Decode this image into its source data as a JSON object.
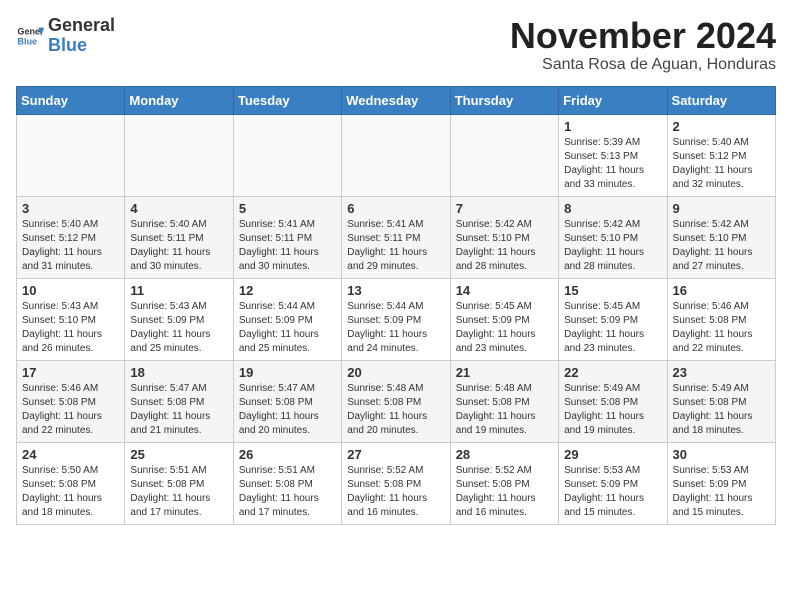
{
  "header": {
    "logo_line1": "General",
    "logo_line2": "Blue",
    "month_title": "November 2024",
    "subtitle": "Santa Rosa de Aguan, Honduras"
  },
  "weekdays": [
    "Sunday",
    "Monday",
    "Tuesday",
    "Wednesday",
    "Thursday",
    "Friday",
    "Saturday"
  ],
  "weeks": [
    [
      {
        "day": "",
        "info": ""
      },
      {
        "day": "",
        "info": ""
      },
      {
        "day": "",
        "info": ""
      },
      {
        "day": "",
        "info": ""
      },
      {
        "day": "",
        "info": ""
      },
      {
        "day": "1",
        "info": "Sunrise: 5:39 AM\nSunset: 5:13 PM\nDaylight: 11 hours\nand 33 minutes."
      },
      {
        "day": "2",
        "info": "Sunrise: 5:40 AM\nSunset: 5:12 PM\nDaylight: 11 hours\nand 32 minutes."
      }
    ],
    [
      {
        "day": "3",
        "info": "Sunrise: 5:40 AM\nSunset: 5:12 PM\nDaylight: 11 hours\nand 31 minutes."
      },
      {
        "day": "4",
        "info": "Sunrise: 5:40 AM\nSunset: 5:11 PM\nDaylight: 11 hours\nand 30 minutes."
      },
      {
        "day": "5",
        "info": "Sunrise: 5:41 AM\nSunset: 5:11 PM\nDaylight: 11 hours\nand 30 minutes."
      },
      {
        "day": "6",
        "info": "Sunrise: 5:41 AM\nSunset: 5:11 PM\nDaylight: 11 hours\nand 29 minutes."
      },
      {
        "day": "7",
        "info": "Sunrise: 5:42 AM\nSunset: 5:10 PM\nDaylight: 11 hours\nand 28 minutes."
      },
      {
        "day": "8",
        "info": "Sunrise: 5:42 AM\nSunset: 5:10 PM\nDaylight: 11 hours\nand 28 minutes."
      },
      {
        "day": "9",
        "info": "Sunrise: 5:42 AM\nSunset: 5:10 PM\nDaylight: 11 hours\nand 27 minutes."
      }
    ],
    [
      {
        "day": "10",
        "info": "Sunrise: 5:43 AM\nSunset: 5:10 PM\nDaylight: 11 hours\nand 26 minutes."
      },
      {
        "day": "11",
        "info": "Sunrise: 5:43 AM\nSunset: 5:09 PM\nDaylight: 11 hours\nand 25 minutes."
      },
      {
        "day": "12",
        "info": "Sunrise: 5:44 AM\nSunset: 5:09 PM\nDaylight: 11 hours\nand 25 minutes."
      },
      {
        "day": "13",
        "info": "Sunrise: 5:44 AM\nSunset: 5:09 PM\nDaylight: 11 hours\nand 24 minutes."
      },
      {
        "day": "14",
        "info": "Sunrise: 5:45 AM\nSunset: 5:09 PM\nDaylight: 11 hours\nand 23 minutes."
      },
      {
        "day": "15",
        "info": "Sunrise: 5:45 AM\nSunset: 5:09 PM\nDaylight: 11 hours\nand 23 minutes."
      },
      {
        "day": "16",
        "info": "Sunrise: 5:46 AM\nSunset: 5:08 PM\nDaylight: 11 hours\nand 22 minutes."
      }
    ],
    [
      {
        "day": "17",
        "info": "Sunrise: 5:46 AM\nSunset: 5:08 PM\nDaylight: 11 hours\nand 22 minutes."
      },
      {
        "day": "18",
        "info": "Sunrise: 5:47 AM\nSunset: 5:08 PM\nDaylight: 11 hours\nand 21 minutes."
      },
      {
        "day": "19",
        "info": "Sunrise: 5:47 AM\nSunset: 5:08 PM\nDaylight: 11 hours\nand 20 minutes."
      },
      {
        "day": "20",
        "info": "Sunrise: 5:48 AM\nSunset: 5:08 PM\nDaylight: 11 hours\nand 20 minutes."
      },
      {
        "day": "21",
        "info": "Sunrise: 5:48 AM\nSunset: 5:08 PM\nDaylight: 11 hours\nand 19 minutes."
      },
      {
        "day": "22",
        "info": "Sunrise: 5:49 AM\nSunset: 5:08 PM\nDaylight: 11 hours\nand 19 minutes."
      },
      {
        "day": "23",
        "info": "Sunrise: 5:49 AM\nSunset: 5:08 PM\nDaylight: 11 hours\nand 18 minutes."
      }
    ],
    [
      {
        "day": "24",
        "info": "Sunrise: 5:50 AM\nSunset: 5:08 PM\nDaylight: 11 hours\nand 18 minutes."
      },
      {
        "day": "25",
        "info": "Sunrise: 5:51 AM\nSunset: 5:08 PM\nDaylight: 11 hours\nand 17 minutes."
      },
      {
        "day": "26",
        "info": "Sunrise: 5:51 AM\nSunset: 5:08 PM\nDaylight: 11 hours\nand 17 minutes."
      },
      {
        "day": "27",
        "info": "Sunrise: 5:52 AM\nSunset: 5:08 PM\nDaylight: 11 hours\nand 16 minutes."
      },
      {
        "day": "28",
        "info": "Sunrise: 5:52 AM\nSunset: 5:08 PM\nDaylight: 11 hours\nand 16 minutes."
      },
      {
        "day": "29",
        "info": "Sunrise: 5:53 AM\nSunset: 5:09 PM\nDaylight: 11 hours\nand 15 minutes."
      },
      {
        "day": "30",
        "info": "Sunrise: 5:53 AM\nSunset: 5:09 PM\nDaylight: 11 hours\nand 15 minutes."
      }
    ]
  ]
}
